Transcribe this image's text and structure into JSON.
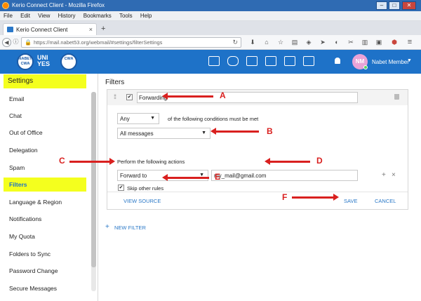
{
  "window": {
    "title": "Kerio Connect Client - Mozilla Firefox",
    "minimize": "–",
    "maximize": "□",
    "close": "✕"
  },
  "menu": [
    "File",
    "Edit",
    "View",
    "History",
    "Bookmarks",
    "Tools",
    "Help"
  ],
  "tab": {
    "label": "Kerio Connect Client",
    "close": "×",
    "new": "+"
  },
  "nav": {
    "back": "◀",
    "forward": "▶",
    "url": "https://mail.nabet53.org/webmail/#settings/filterSettings",
    "reload": "↻"
  },
  "header": {
    "logo_badge_1": "NABET CWA",
    "logo_text_1": "UNI\nYES",
    "logo_badge_2": "CWA",
    "user_initials": "NM",
    "user_name": "Nabet Member",
    "user_caret": "▼"
  },
  "sidebar": {
    "heading": "Settings",
    "items": [
      "Email",
      "Chat",
      "Out of Office",
      "Delegation",
      "Spam",
      "Filters",
      "Language & Region",
      "Notifications",
      "My Quota",
      "Folders to Sync",
      "Password Change",
      "Secure Messages"
    ],
    "active": "Filters"
  },
  "main": {
    "title": "Filters",
    "filter": {
      "grip": "⁞⁞",
      "enabled_check": "✔",
      "name": "Forwarding",
      "match_mode": "Any",
      "match_mode_caret": "▼",
      "conditions_text": "of the following conditions must be met",
      "condition": "All messages",
      "condition_caret": "▼",
      "actions_text": "Perform the following actions",
      "action": "Forward to",
      "action_caret": "▼",
      "forward_address": "my_mail@gmail.com",
      "add": "+",
      "remove": "×",
      "skip_check": "✔",
      "skip_label": "Skip other rules",
      "view_source": "VIEW SOURCE",
      "save": "SAVE",
      "cancel": "CANCEL"
    },
    "new_filter_plus": "+",
    "new_filter": "NEW FILTER"
  },
  "annotations": {
    "a": "A",
    "b": "B",
    "c": "C",
    "d": "D",
    "e": "E",
    "f": "F"
  },
  "colors": {
    "header_blue": "#1e72c8",
    "highlight_yellow": "#f4ff1e",
    "annotation_red": "#d9201f",
    "link_blue": "#2a78c7"
  }
}
